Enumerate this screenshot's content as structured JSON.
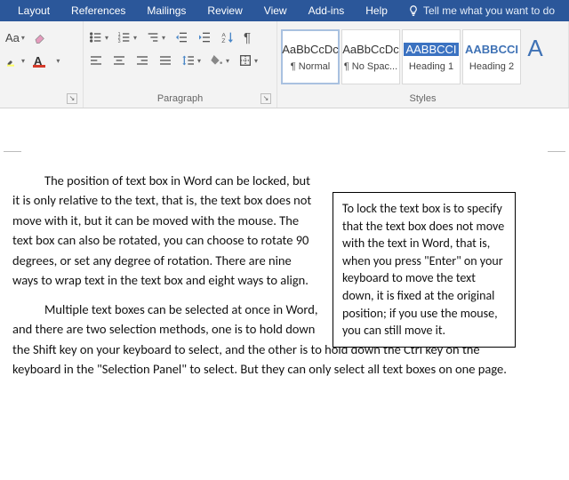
{
  "tabs": {
    "layout": "Layout",
    "references": "References",
    "mailings": "Mailings",
    "review": "Review",
    "view": "View",
    "addins": "Add-ins",
    "help": "Help",
    "tellme": "Tell me what you want to do"
  },
  "font_group": {
    "label": "",
    "grow": "A",
    "shrink": "A",
    "aa": "Aa",
    "clear": "",
    "color_letter": "A",
    "highlight_letter": "A"
  },
  "paragraph_group": {
    "label": "Paragraph"
  },
  "styles_group": {
    "label": "Styles",
    "tiles": [
      {
        "sample": "AaBbCcDc",
        "name": "¶ Normal",
        "cls": "",
        "sel": true
      },
      {
        "sample": "AaBbCcDc",
        "name": "¶ No Spac...",
        "cls": "",
        "sel": false
      },
      {
        "sample": "AABBCCI",
        "name": "Heading 1",
        "cls": "whiteblue",
        "sel": false
      },
      {
        "sample": "AABBCCI",
        "name": "Heading 2",
        "cls": "blue",
        "sel": false
      }
    ]
  },
  "document": {
    "p1": "The position of text box in Word can be locked, but it is only relative to the text, that is, the text box does not move with it, but it can be moved with the mouse. The text box can also be rotated, you can choose to rotate 90 degrees, or set any degree of rotation. There are nine ways to wrap text in the text box and eight ways to align.",
    "p2": "Multiple text boxes can be selected at once in Word, and there are two selection methods, one is to hold down the Shift key on your keyboard to select, and the other is to hold down the Ctrl key on the keyboard in the \"Selection Panel\" to select. But they can only select all text boxes on one page.",
    "textbox": "To lock the text box is to specify that the text box does not move with the text in Word, that is, when you press \"Enter\" on your keyboard to move the text down, it is fixed at the original position; if you use the mouse, you can still move it."
  }
}
